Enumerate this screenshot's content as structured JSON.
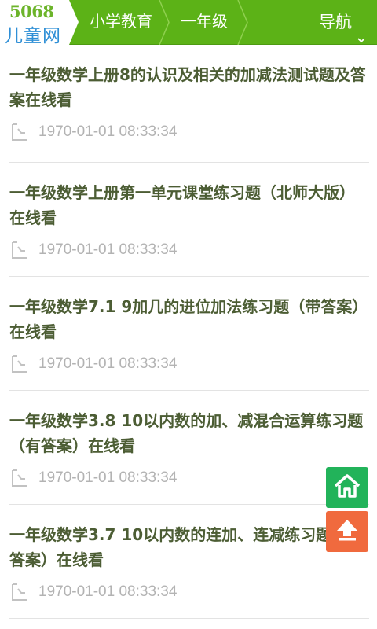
{
  "header": {
    "logo_top": "5068",
    "logo_bottom": "儿童网",
    "breadcrumb": [
      "小学教育",
      "一年级"
    ],
    "nav_label": "导航"
  },
  "items": [
    {
      "title": "一年级数学上册8的认识及相关的加减法测试题及答案在线看",
      "time": "1970-01-01 08:33:34"
    },
    {
      "title": "一年级数学上册第一单元课堂练习题（北师大版）在线看",
      "time": "1970-01-01 08:33:34"
    },
    {
      "title": "一年级数学7.1 9加几的进位加法练习题（带答案）在线看",
      "time": "1970-01-01 08:33:34"
    },
    {
      "title": "一年级数学3.8 10以内数的加、减混合运算练习题（有答案）在线看",
      "time": "1970-01-01 08:33:34"
    },
    {
      "title": "一年级数学3.7 10以内数的连加、连减练习题（附答案）在线看",
      "time": "1970-01-01 08:33:34"
    }
  ],
  "colors": {
    "header_bg": "#5cb217",
    "title_text": "#4c5d34",
    "time_text": "#b3b3b3",
    "home_button": "#22b35a",
    "top_button": "#f06a3e"
  },
  "icons": {
    "home": "home-icon",
    "back_to_top": "arrow-up-icon",
    "time": "clock-icon",
    "nav": "chevron-down-icon"
  }
}
